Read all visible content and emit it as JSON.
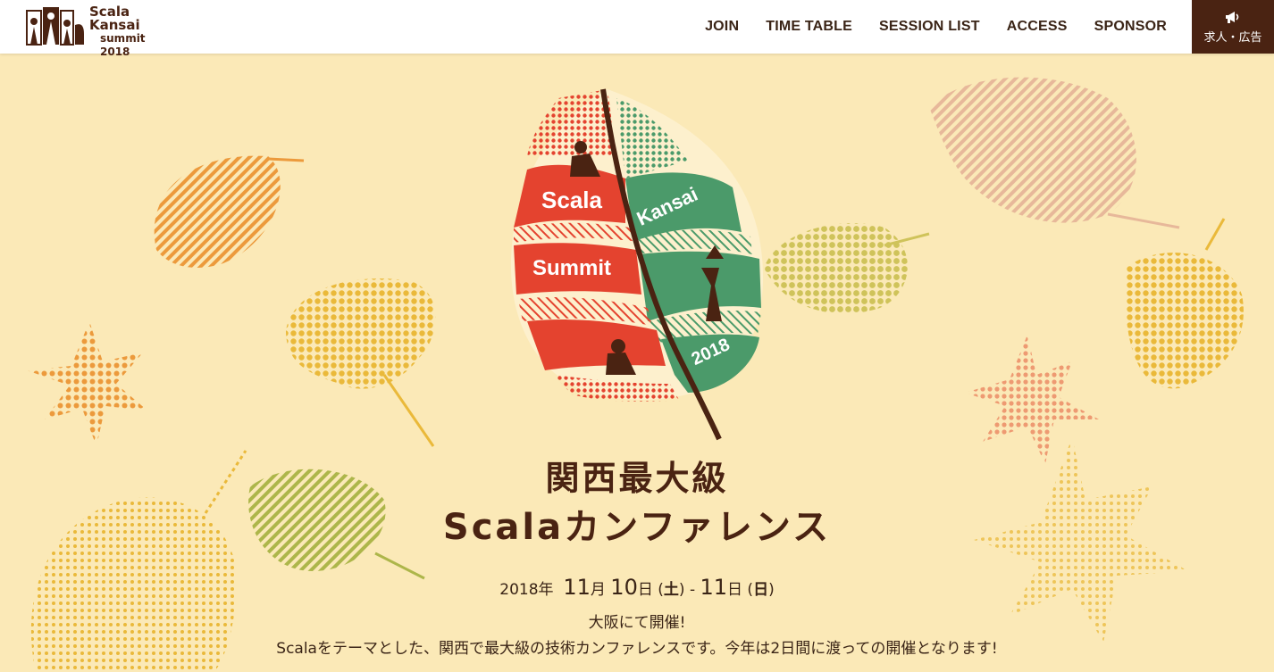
{
  "logo": {
    "line1": "Scala",
    "line2": "Kansai",
    "line3": "summit 2018"
  },
  "nav": {
    "items": [
      {
        "label": "JOIN"
      },
      {
        "label": "TIME TABLE"
      },
      {
        "label": "SESSION LIST"
      },
      {
        "label": "ACCESS"
      },
      {
        "label": "SPONSOR"
      }
    ],
    "ad_label": "求人・広告",
    "ad_icon": "megaphone-icon"
  },
  "hero": {
    "emblem": {
      "word1": "Scala",
      "word2": "Summit",
      "word3": "Kansai",
      "year": "2018"
    },
    "title_line1": "関西最大級",
    "title_line2": "Scalaカンファレンス",
    "date": {
      "year": "2018年",
      "month1": "11",
      "m1": "月",
      "day1": "10",
      "d1": "日",
      "wd1": "土",
      "sep": "-",
      "month2": "11",
      "d2": "日",
      "wd2": "日"
    },
    "venue": "大阪にて開催!",
    "description": "Scalaをテーマとした、関西で最大級の技術カンファレンスです。今年は2日間に渡っての開催となります!"
  },
  "colors": {
    "background": "#fbe9b7",
    "brown": "#4a2312",
    "red": "#e4432f",
    "green": "#4b9a6a",
    "orange": "#ec9a3c",
    "yellow": "#eab93a",
    "olive": "#b8bb4a"
  }
}
